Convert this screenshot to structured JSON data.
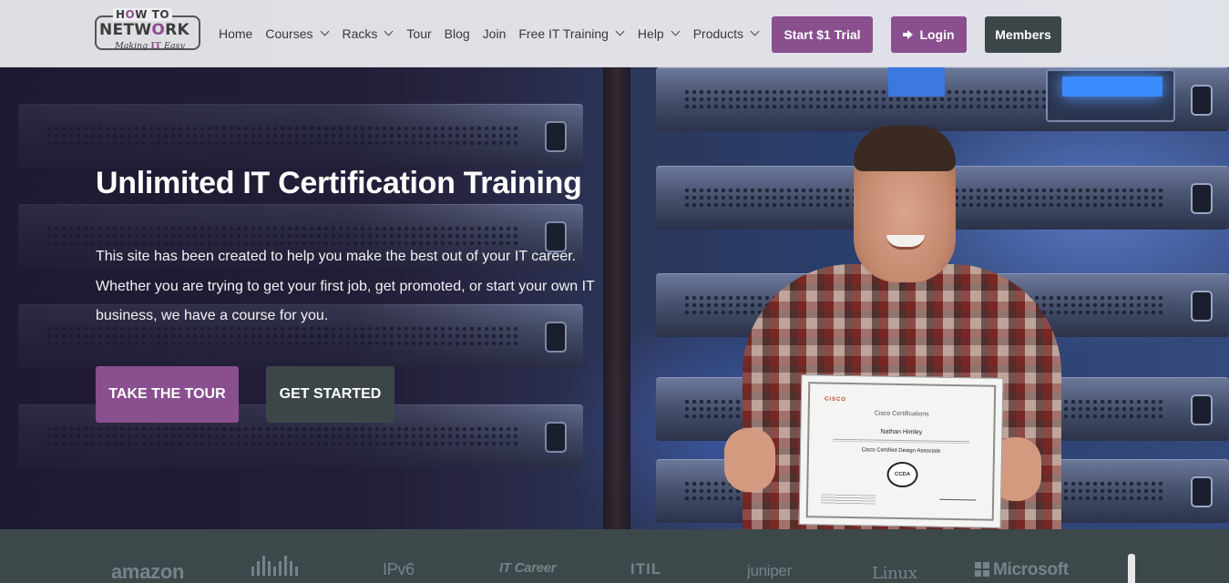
{
  "logo": {
    "line1_a": "H",
    "line1_o": "O",
    "line1_b": "W TO",
    "line2_a": "NETW",
    "line2_o": "O",
    "line2_b": "RK",
    "tagline_a": "Making ",
    "tagline_it": "IT",
    "tagline_b": " Easy"
  },
  "nav": {
    "items": [
      {
        "label": "Home",
        "dropdown": false
      },
      {
        "label": "Courses",
        "dropdown": true
      },
      {
        "label": "Racks",
        "dropdown": true
      },
      {
        "label": "Tour",
        "dropdown": false
      },
      {
        "label": "Blog",
        "dropdown": false
      },
      {
        "label": "Join",
        "dropdown": false
      },
      {
        "label": "Free IT Training",
        "dropdown": true
      },
      {
        "label": "Help",
        "dropdown": true
      },
      {
        "label": "Products",
        "dropdown": true
      }
    ],
    "trial_label": "Start $1 Trial",
    "login_label": "Login",
    "members_label": "Members"
  },
  "hero": {
    "title": "Unlimited IT Certification Training",
    "paragraph_line1": "This site has been created to help you make the best out of your IT career.",
    "paragraph_line2": "Whether you are trying to get your first job, get promoted, or start your own IT",
    "paragraph_line3": "business, we have a course for you.",
    "tour_button": "TAKE THE TOUR",
    "start_button": "GET STARTED"
  },
  "certificate": {
    "logo": "CISCO",
    "title": "Cisco Certifications",
    "name": "Nathan Himley",
    "course": "Cisco Certified Design Associate",
    "badge": "CCDA"
  },
  "partners": [
    "amazon",
    "IPv6",
    "IT Career",
    "ITIL",
    "juniper",
    "Linux",
    "Microsoft"
  ],
  "colors": {
    "brand_purple": "#8a4f8f",
    "dark_slate": "#3c4649",
    "header_bg": "#eeeef1",
    "strip_bg": "#3d484b"
  }
}
